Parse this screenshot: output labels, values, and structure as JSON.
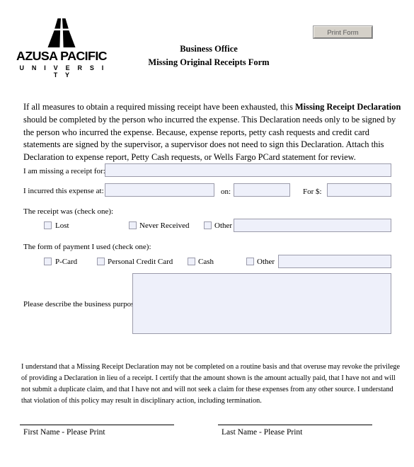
{
  "header": {
    "logo": {
      "mark_name": "azusa-pacific-a-monogram",
      "wordmark": "AZUSA PACIFIC",
      "sub_wordmark": "U N I V E R S I T Y"
    },
    "title_line1": "Business Office",
    "title_line2": "Missing Original Receipts Form",
    "print_button_label": "Print Form"
  },
  "intro": {
    "before_bold": "If all measures to obtain a required missing receipt have been exhausted, this ",
    "bold": "Missing Receipt Declaration",
    "after_bold": " should be completed by the person who incurred the expense.  This Declaration needs only to be signed by the person who incurred the expense.  Because, expense reports, petty cash requests and credit card statements are signed by the supervisor, a supervisor does not need to sign this Declaration.  Attach this Declaration to expense report, Petty Cash requests, or Wells Fargo PCard statement for review."
  },
  "fields": {
    "missing_receipt_label": "I am missing a receipt for:",
    "missing_receipt_value": "",
    "incurred_at_label": "I incurred this expense at:",
    "incurred_at_value": "",
    "on_label": "on:",
    "on_value": "",
    "amount_label": "For $:",
    "amount_value": ""
  },
  "receipt_status": {
    "group_label": "The receipt was (check one):",
    "options": [
      {
        "label": "Lost",
        "checked": false
      },
      {
        "label": "Never Received",
        "checked": false
      },
      {
        "label": "Other",
        "checked": false
      }
    ],
    "other_value": ""
  },
  "payment_form": {
    "group_label": "The form of payment I used (check one):",
    "options": [
      {
        "label": "P-Card",
        "checked": false
      },
      {
        "label": "Personal Credit Card",
        "checked": false
      },
      {
        "label": "Cash",
        "checked": false
      },
      {
        "label": "Other",
        "checked": false
      }
    ],
    "other_value": ""
  },
  "business_purpose": {
    "label": "Please describe the business purpose:",
    "value": ""
  },
  "disclaimer": {
    "text": "I understand that a Missing Receipt Declaration may not be completed on a routine basis and that overuse may revoke the privilege of providing a Declaration in lieu of a receipt.  I certify that the amount shown is the amount actually paid, that I have not and will not submit a duplicate claim, and that I have not and will not seek a claim for these expenses from any other source.  I understand that violation of this policy may result in disciplinary action, including termination."
  },
  "signatures": {
    "first_name_caption": "First Name - Please Print",
    "last_name_caption": "Last Name - Please Print"
  },
  "colors": {
    "field_fill": "#eef0fa",
    "field_border": "#9b9bab",
    "button_face": "#d4d0c8",
    "button_text": "#5a5a5a",
    "text": "#000000"
  }
}
